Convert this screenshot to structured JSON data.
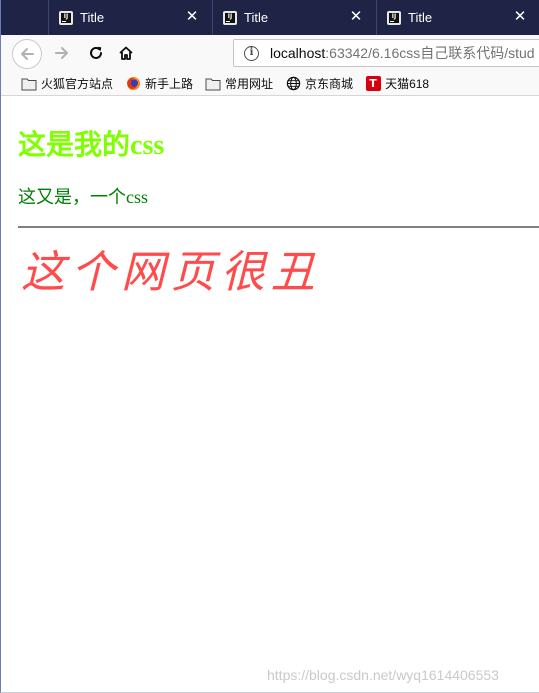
{
  "tabs": [
    {
      "title": "Title",
      "icon": "intellij-icon"
    },
    {
      "title": "Title",
      "icon": "intellij-icon"
    },
    {
      "title": "Title",
      "icon": "intellij-icon"
    }
  ],
  "tab_icon_glyph": "IJ",
  "close_glyph": "✕",
  "navbar": {
    "url_host": "localhost",
    "url_rest": ":63342/6.16css自己联系代码/stud"
  },
  "bookmarks": [
    {
      "label": "火狐官方站点",
      "icon": "folder-icon"
    },
    {
      "label": "新手上路",
      "icon": "firefox-icon"
    },
    {
      "label": "常用网址",
      "icon": "folder-icon"
    },
    {
      "label": "京东商城",
      "icon": "globe-icon"
    },
    {
      "label": "天猫618",
      "icon": "tmall-icon"
    }
  ],
  "tmall_glyph": "T",
  "page": {
    "heading_cjk": "这是我的",
    "heading_latin": "css",
    "heading_color": "#7fff00",
    "para_cjk": "这又是，一个",
    "para_latin": "css",
    "para_color": "#008000",
    "ugly_text": "这个网页很丑",
    "ugly_color": "#ff4b4b"
  },
  "watermark": "https://blog.csdn.net/wyq1614406553",
  "colors": {
    "tabstrip_bg": "#1f2447",
    "toolbar_bg": "#f9f9fa"
  }
}
